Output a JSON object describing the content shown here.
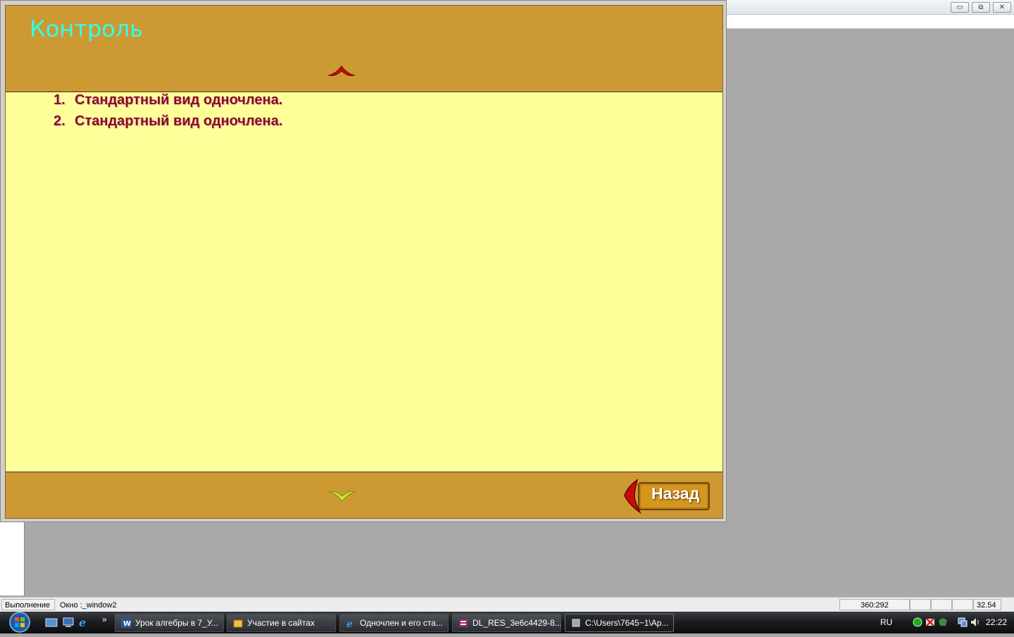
{
  "app": {
    "title": "Контроль",
    "items": [
      {
        "num": "1.",
        "text": "Стандартный вид одночлена."
      },
      {
        "num": "2.",
        "text": "Стандартный вид одночлена."
      }
    ],
    "back_label": "Назад"
  },
  "host_window": {
    "buttons": {
      "minimize": "▭",
      "restore": "⧉",
      "close": "✕"
    }
  },
  "status_bar": {
    "mode": "Выполнение",
    "window": "Окно :_window2",
    "coords": "360:292",
    "value": "32.54"
  },
  "taskbar": {
    "tasks": [
      {
        "label": "Урок алгебры в 7_У...",
        "icon": "word-icon"
      },
      {
        "label": "Участие в сайтах",
        "icon": "folder-icon"
      },
      {
        "label": "Одночлен и его ста...",
        "icon": "ie-icon"
      },
      {
        "label": "DL_RES_3e6c4429-8...",
        "icon": "archive-icon"
      },
      {
        "label": "C:\\Users\\7645~1\\Ap...",
        "icon": "app-icon"
      }
    ],
    "overflow": "»",
    "language": "RU",
    "clock": "22:22"
  },
  "colors": {
    "frame": "#cc9933",
    "content": "#ffff99",
    "title": "#33ffee",
    "item_text": "#8b0a2a"
  }
}
